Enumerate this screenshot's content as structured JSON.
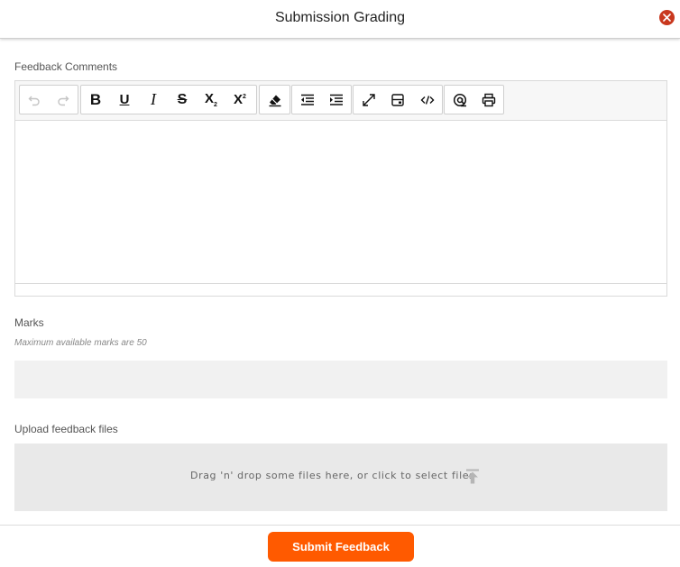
{
  "modal": {
    "title": "Submission Grading"
  },
  "feedback": {
    "label": "Feedback Comments",
    "toolbar": {
      "undo": "undo-icon",
      "redo": "redo-icon",
      "bold": "B",
      "underline": "U",
      "italic": "I",
      "strikethrough": "S",
      "subscript": "X",
      "subscript_mark": "2",
      "superscript": "X",
      "superscript_mark": "2",
      "icons": [
        "undo-icon",
        "redo-icon",
        "bold-icon",
        "underline-icon",
        "italic-icon",
        "strikethrough-icon",
        "subscript-icon",
        "superscript-icon",
        "eraser-icon",
        "outdent-icon",
        "indent-icon",
        "fullscreen-icon",
        "preview-icon",
        "code-icon",
        "mention-icon",
        "print-icon"
      ]
    },
    "content": ""
  },
  "marks": {
    "label": "Marks",
    "hint": "Maximum available marks are 50",
    "value": "",
    "placeholder": ""
  },
  "upload": {
    "label": "Upload feedback files",
    "dropzone_text": "Drag 'n' drop some files here, or click to select files"
  },
  "footer": {
    "submit_label": "Submit Feedback"
  },
  "colors": {
    "accent": "#ff5a00",
    "close": "#c9381e"
  }
}
